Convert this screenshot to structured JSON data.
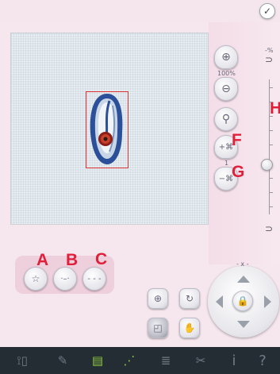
{
  "zoom": {
    "percent_label": "100%",
    "scale_label": "-%"
  },
  "stitch": {
    "count_label": "1"
  },
  "pan": {
    "axis_label": "- x -"
  },
  "callouts": {
    "a": "A",
    "b": "B",
    "c": "C",
    "f": "F",
    "g": "G",
    "h": "H"
  },
  "colors": {
    "accent_red": "#e0203a",
    "panel_pink": "#f6e7ee",
    "taskbar": "#242c34",
    "design_blue": "#2c4f9a"
  },
  "icons": {
    "confirm": "checkmark-icon",
    "zoom_in": "zoom-in-icon",
    "zoom_out": "zoom-out-icon",
    "zoom_box": "magnifier-icon",
    "stitch_plus": "stitch-plus-icon",
    "stitch_minus": "stitch-minus-icon",
    "hoop_top": "hoop-magnet-icon",
    "hoop_bottom": "hoop-magnet-icon",
    "lock": "lock-icon"
  }
}
